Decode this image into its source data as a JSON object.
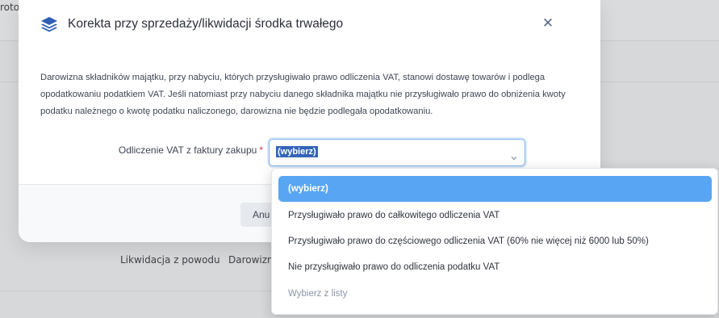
{
  "background": {
    "partial_top_text": "rotol",
    "row_text_1": "Likwidacja z powodu",
    "row_text_2": "Darowizn"
  },
  "modal": {
    "title": "Korekta przy sprzedaży/likwidacji środka trwałego",
    "close_symbol": "✕",
    "description": "Darowizna składników majątku, przy nabyciu, których przysługiwało prawo odliczenia VAT, stanowi dostawę towarów i podlega opodatkowaniu podatkiem VAT. Jeśli natomiast przy nabyciu danego składnika majątku nie przysługiwało prawo do obniżenia kwoty podatku należnego o kwotę podatku naliczonego, darowizna nie będzie podlegała opodatkowaniu.",
    "field": {
      "label": "Odliczenie VAT z faktury zakupu",
      "required_mark": "*",
      "selected_value": "(wybierz)"
    },
    "cancel_button_label": "Anu"
  },
  "dropdown": {
    "options": [
      "(wybierz)",
      "Przysługiwało prawo do całkowitego odliczenia VAT",
      "Przysługiwało prawo do częściowego odliczenia VAT (60% nie więcej niż 6000 lub 50%)",
      "Nie przysługiwało prawo do odliczenia podatku VAT",
      "Wybierz z listy"
    ]
  },
  "colors": {
    "accent": "#58a6f3",
    "selected_text_bg": "#3465b8",
    "required": "#d0384b",
    "icon": "#2f5fb3"
  },
  "icons": {
    "title_icon": "layers-icon",
    "close_icon": "close-icon",
    "select_icon": "chevron-down-icon"
  }
}
